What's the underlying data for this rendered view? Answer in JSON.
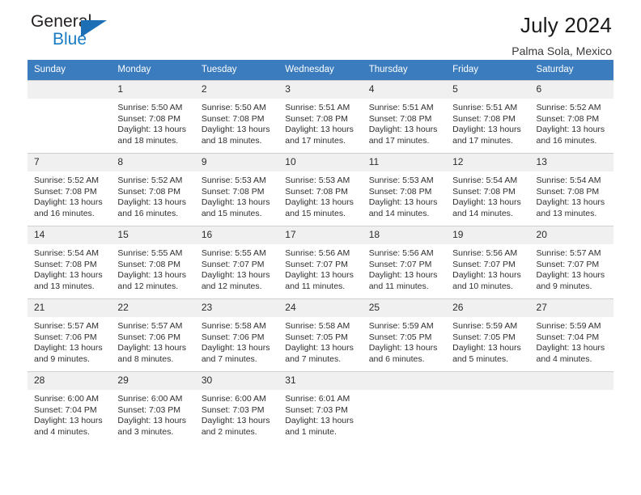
{
  "brand": {
    "name_top": "General",
    "name_bottom": "Blue",
    "triangle_icon": "brand-triangle-icon",
    "color_top": "#231f20",
    "color_bottom": "#1a7cc4",
    "triangle_color": "#1c6fb5"
  },
  "header": {
    "title": "July 2024",
    "subtitle": "Palma Sola, Mexico"
  },
  "theme": {
    "header_row_bg": "#3a7cbe",
    "daynum_bg": "#f0f0f0",
    "grid_line": "#cfcfcf",
    "text": "#2f2f2f"
  },
  "weekday_headers": [
    "Sunday",
    "Monday",
    "Tuesday",
    "Wednesday",
    "Thursday",
    "Friday",
    "Saturday"
  ],
  "weeks": [
    [
      {
        "day": "",
        "sunrise": "",
        "sunset": "",
        "daylight_line1": "",
        "daylight_line2": ""
      },
      {
        "day": "1",
        "sunrise": "Sunrise: 5:50 AM",
        "sunset": "Sunset: 7:08 PM",
        "daylight_line1": "Daylight: 13 hours",
        "daylight_line2": "and 18 minutes."
      },
      {
        "day": "2",
        "sunrise": "Sunrise: 5:50 AM",
        "sunset": "Sunset: 7:08 PM",
        "daylight_line1": "Daylight: 13 hours",
        "daylight_line2": "and 18 minutes."
      },
      {
        "day": "3",
        "sunrise": "Sunrise: 5:51 AM",
        "sunset": "Sunset: 7:08 PM",
        "daylight_line1": "Daylight: 13 hours",
        "daylight_line2": "and 17 minutes."
      },
      {
        "day": "4",
        "sunrise": "Sunrise: 5:51 AM",
        "sunset": "Sunset: 7:08 PM",
        "daylight_line1": "Daylight: 13 hours",
        "daylight_line2": "and 17 minutes."
      },
      {
        "day": "5",
        "sunrise": "Sunrise: 5:51 AM",
        "sunset": "Sunset: 7:08 PM",
        "daylight_line1": "Daylight: 13 hours",
        "daylight_line2": "and 17 minutes."
      },
      {
        "day": "6",
        "sunrise": "Sunrise: 5:52 AM",
        "sunset": "Sunset: 7:08 PM",
        "daylight_line1": "Daylight: 13 hours",
        "daylight_line2": "and 16 minutes."
      }
    ],
    [
      {
        "day": "7",
        "sunrise": "Sunrise: 5:52 AM",
        "sunset": "Sunset: 7:08 PM",
        "daylight_line1": "Daylight: 13 hours",
        "daylight_line2": "and 16 minutes."
      },
      {
        "day": "8",
        "sunrise": "Sunrise: 5:52 AM",
        "sunset": "Sunset: 7:08 PM",
        "daylight_line1": "Daylight: 13 hours",
        "daylight_line2": "and 16 minutes."
      },
      {
        "day": "9",
        "sunrise": "Sunrise: 5:53 AM",
        "sunset": "Sunset: 7:08 PM",
        "daylight_line1": "Daylight: 13 hours",
        "daylight_line2": "and 15 minutes."
      },
      {
        "day": "10",
        "sunrise": "Sunrise: 5:53 AM",
        "sunset": "Sunset: 7:08 PM",
        "daylight_line1": "Daylight: 13 hours",
        "daylight_line2": "and 15 minutes."
      },
      {
        "day": "11",
        "sunrise": "Sunrise: 5:53 AM",
        "sunset": "Sunset: 7:08 PM",
        "daylight_line1": "Daylight: 13 hours",
        "daylight_line2": "and 14 minutes."
      },
      {
        "day": "12",
        "sunrise": "Sunrise: 5:54 AM",
        "sunset": "Sunset: 7:08 PM",
        "daylight_line1": "Daylight: 13 hours",
        "daylight_line2": "and 14 minutes."
      },
      {
        "day": "13",
        "sunrise": "Sunrise: 5:54 AM",
        "sunset": "Sunset: 7:08 PM",
        "daylight_line1": "Daylight: 13 hours",
        "daylight_line2": "and 13 minutes."
      }
    ],
    [
      {
        "day": "14",
        "sunrise": "Sunrise: 5:54 AM",
        "sunset": "Sunset: 7:08 PM",
        "daylight_line1": "Daylight: 13 hours",
        "daylight_line2": "and 13 minutes."
      },
      {
        "day": "15",
        "sunrise": "Sunrise: 5:55 AM",
        "sunset": "Sunset: 7:08 PM",
        "daylight_line1": "Daylight: 13 hours",
        "daylight_line2": "and 12 minutes."
      },
      {
        "day": "16",
        "sunrise": "Sunrise: 5:55 AM",
        "sunset": "Sunset: 7:07 PM",
        "daylight_line1": "Daylight: 13 hours",
        "daylight_line2": "and 12 minutes."
      },
      {
        "day": "17",
        "sunrise": "Sunrise: 5:56 AM",
        "sunset": "Sunset: 7:07 PM",
        "daylight_line1": "Daylight: 13 hours",
        "daylight_line2": "and 11 minutes."
      },
      {
        "day": "18",
        "sunrise": "Sunrise: 5:56 AM",
        "sunset": "Sunset: 7:07 PM",
        "daylight_line1": "Daylight: 13 hours",
        "daylight_line2": "and 11 minutes."
      },
      {
        "day": "19",
        "sunrise": "Sunrise: 5:56 AM",
        "sunset": "Sunset: 7:07 PM",
        "daylight_line1": "Daylight: 13 hours",
        "daylight_line2": "and 10 minutes."
      },
      {
        "day": "20",
        "sunrise": "Sunrise: 5:57 AM",
        "sunset": "Sunset: 7:07 PM",
        "daylight_line1": "Daylight: 13 hours",
        "daylight_line2": "and 9 minutes."
      }
    ],
    [
      {
        "day": "21",
        "sunrise": "Sunrise: 5:57 AM",
        "sunset": "Sunset: 7:06 PM",
        "daylight_line1": "Daylight: 13 hours",
        "daylight_line2": "and 9 minutes."
      },
      {
        "day": "22",
        "sunrise": "Sunrise: 5:57 AM",
        "sunset": "Sunset: 7:06 PM",
        "daylight_line1": "Daylight: 13 hours",
        "daylight_line2": "and 8 minutes."
      },
      {
        "day": "23",
        "sunrise": "Sunrise: 5:58 AM",
        "sunset": "Sunset: 7:06 PM",
        "daylight_line1": "Daylight: 13 hours",
        "daylight_line2": "and 7 minutes."
      },
      {
        "day": "24",
        "sunrise": "Sunrise: 5:58 AM",
        "sunset": "Sunset: 7:05 PM",
        "daylight_line1": "Daylight: 13 hours",
        "daylight_line2": "and 7 minutes."
      },
      {
        "day": "25",
        "sunrise": "Sunrise: 5:59 AM",
        "sunset": "Sunset: 7:05 PM",
        "daylight_line1": "Daylight: 13 hours",
        "daylight_line2": "and 6 minutes."
      },
      {
        "day": "26",
        "sunrise": "Sunrise: 5:59 AM",
        "sunset": "Sunset: 7:05 PM",
        "daylight_line1": "Daylight: 13 hours",
        "daylight_line2": "and 5 minutes."
      },
      {
        "day": "27",
        "sunrise": "Sunrise: 5:59 AM",
        "sunset": "Sunset: 7:04 PM",
        "daylight_line1": "Daylight: 13 hours",
        "daylight_line2": "and 4 minutes."
      }
    ],
    [
      {
        "day": "28",
        "sunrise": "Sunrise: 6:00 AM",
        "sunset": "Sunset: 7:04 PM",
        "daylight_line1": "Daylight: 13 hours",
        "daylight_line2": "and 4 minutes."
      },
      {
        "day": "29",
        "sunrise": "Sunrise: 6:00 AM",
        "sunset": "Sunset: 7:03 PM",
        "daylight_line1": "Daylight: 13 hours",
        "daylight_line2": "and 3 minutes."
      },
      {
        "day": "30",
        "sunrise": "Sunrise: 6:00 AM",
        "sunset": "Sunset: 7:03 PM",
        "daylight_line1": "Daylight: 13 hours",
        "daylight_line2": "and 2 minutes."
      },
      {
        "day": "31",
        "sunrise": "Sunrise: 6:01 AM",
        "sunset": "Sunset: 7:03 PM",
        "daylight_line1": "Daylight: 13 hours",
        "daylight_line2": "and 1 minute."
      },
      {
        "day": "",
        "sunrise": "",
        "sunset": "",
        "daylight_line1": "",
        "daylight_line2": ""
      },
      {
        "day": "",
        "sunrise": "",
        "sunset": "",
        "daylight_line1": "",
        "daylight_line2": ""
      },
      {
        "day": "",
        "sunrise": "",
        "sunset": "",
        "daylight_line1": "",
        "daylight_line2": ""
      }
    ]
  ]
}
